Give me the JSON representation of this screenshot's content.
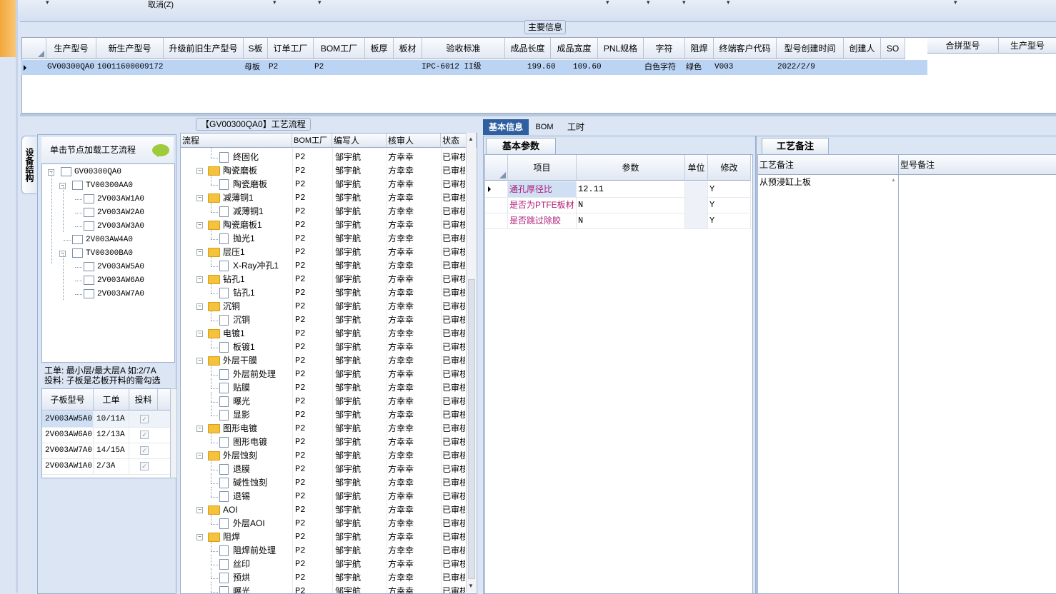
{
  "toolbar": {
    "cancel_label": "取消(Z)"
  },
  "main_info": {
    "section_title": "主要信息",
    "columns": [
      "生产型号",
      "新生产型号",
      "升级前旧生产型号",
      "S板",
      "订单工厂",
      "BOM工厂",
      "板厚",
      "板材",
      "验收标准",
      "成品长度",
      "成品宽度",
      "PNL规格",
      "字符",
      "阻焊",
      "终端客户代码",
      "型号创建时间",
      "创建人",
      "SO"
    ],
    "row": {
      "model": "GV00300QA0",
      "new_model": "10011600009172",
      "s_board": "母板",
      "order_factory": "P2",
      "bom_factory": "P2",
      "standard": "IPC-6012 II级",
      "length": "199.60",
      "width": "109.60",
      "char": "白色字符",
      "solder": "绿色",
      "customer_code": "V003",
      "created": "2022/2/9"
    },
    "side_columns": [
      "合拼型号",
      "生产型号"
    ]
  },
  "left_tab": {
    "label": "设备结构"
  },
  "tree_panel": {
    "hint": "单击节点加载工艺流程",
    "nodes": [
      "GV00300QA0",
      "TV00300AA0",
      "2V003AW1A0",
      "2V003AW2A0",
      "2V003AW3A0",
      "2V003AW4A0",
      "TV00300BA0",
      "2V003AW5A0",
      "2V003AW6A0",
      "2V003AW7A0"
    ],
    "legend1": "工单: 最小层/最大层A 如:2/7A",
    "legend2": "投料: 子板是芯板开料的需勾选"
  },
  "sub_grid": {
    "columns": [
      "子板型号",
      "工单",
      "投料"
    ],
    "rows": [
      {
        "model": "2V003AW5A0",
        "order": "10/11A"
      },
      {
        "model": "2V003AW6A0",
        "order": "12/13A"
      },
      {
        "model": "2V003AW7A0",
        "order": "14/15A"
      },
      {
        "model": "2V003AW1A0",
        "order": "2/3A"
      }
    ]
  },
  "flow": {
    "title": "【GV00300QA0】工艺流程",
    "columns": [
      "流程",
      "BOM工厂",
      "编写人",
      "核审人",
      "状态"
    ],
    "factory": "P2",
    "writer": "邹宇航",
    "reviewer": "方幸幸",
    "status": "已审核",
    "rows": [
      {
        "name": "终固化",
        "type": "doc"
      },
      {
        "name": "陶瓷磨板",
        "type": "folder"
      },
      {
        "name": "陶瓷磨板",
        "type": "doc"
      },
      {
        "name": "减薄铜1",
        "type": "folder"
      },
      {
        "name": "减薄铜1",
        "type": "doc"
      },
      {
        "name": "陶瓷磨板1",
        "type": "folder"
      },
      {
        "name": "抛光1",
        "type": "doc"
      },
      {
        "name": "层压1",
        "type": "folder"
      },
      {
        "name": "X-Ray冲孔1",
        "type": "doc"
      },
      {
        "name": "钻孔1",
        "type": "folder"
      },
      {
        "name": "钻孔1",
        "type": "doc"
      },
      {
        "name": "沉铜",
        "type": "folder"
      },
      {
        "name": "沉铜",
        "type": "doc"
      },
      {
        "name": "电镀1",
        "type": "folder"
      },
      {
        "name": "板镀1",
        "type": "doc"
      },
      {
        "name": "外层干膜",
        "type": "folder"
      },
      {
        "name": "外层前处理",
        "type": "doc"
      },
      {
        "name": "贴膜",
        "type": "doc"
      },
      {
        "name": "曝光",
        "type": "doc"
      },
      {
        "name": "显影",
        "type": "doc"
      },
      {
        "name": "图形电镀",
        "type": "folder"
      },
      {
        "name": "图形电镀",
        "type": "doc"
      },
      {
        "name": "外层蚀刻",
        "type": "folder"
      },
      {
        "name": "退膜",
        "type": "doc"
      },
      {
        "name": "碱性蚀刻",
        "type": "doc"
      },
      {
        "name": "退锡",
        "type": "doc"
      },
      {
        "name": "AOI",
        "type": "folder"
      },
      {
        "name": "外层AOI",
        "type": "doc"
      },
      {
        "name": "阻焊",
        "type": "folder"
      },
      {
        "name": "阻焊前处理",
        "type": "doc"
      },
      {
        "name": "丝印",
        "type": "doc"
      },
      {
        "name": "预烘",
        "type": "doc"
      },
      {
        "name": "曝光",
        "type": "doc"
      }
    ]
  },
  "tabs": [
    "基本信息",
    "BOM",
    "工时"
  ],
  "basic_params": {
    "title": "基本参数",
    "columns": [
      "项目",
      "参数",
      "单位",
      "修改"
    ],
    "rows": [
      {
        "item": "通孔厚径比",
        "param": "12.11",
        "unit": "",
        "edit": "Y"
      },
      {
        "item": "是否为PTFE板材",
        "param": "N",
        "unit": "",
        "edit": "Y"
      },
      {
        "item": "是否跳过除胶",
        "param": "N",
        "unit": "",
        "edit": "Y"
      }
    ]
  },
  "process_notes": {
    "title": "工艺备注",
    "col1": "工艺备注",
    "col2": "型号备注",
    "note_text": "从预浸缸上板"
  },
  "colors": {
    "accent_orange": "#f3a63a",
    "selection": "#bcd4f3",
    "highlight_text": "#b0207a"
  }
}
